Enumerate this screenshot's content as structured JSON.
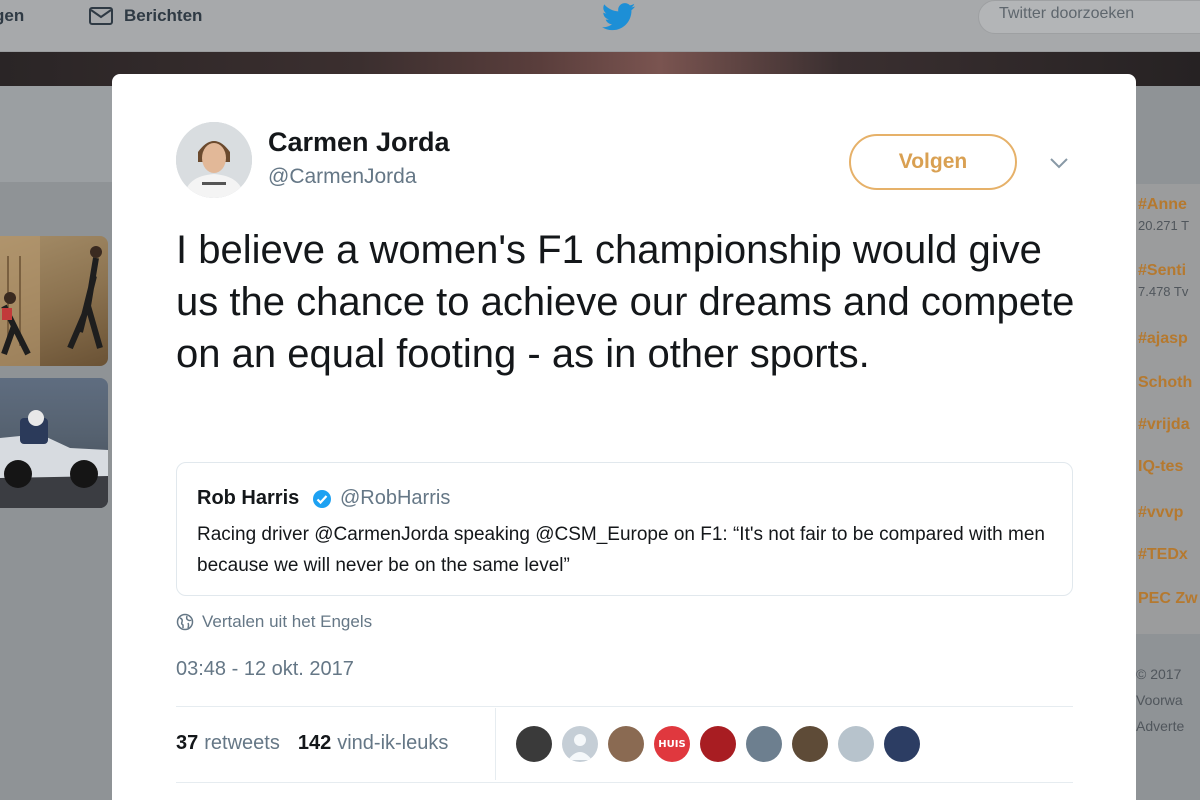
{
  "nav": {
    "left_partial": "gen",
    "messages_label": "Berichten",
    "search_placeholder": "Twitter doorzoeken"
  },
  "tweet": {
    "author_name": "Carmen Jorda",
    "author_handle": "@CarmenJorda",
    "follow_label": "Volgen",
    "text": "I believe a women's F1 championship would give us the chance to achieve our dreams and compete on an equal footing - as in other sports.",
    "quoted": {
      "name": "Rob Harris",
      "handle": "@RobHarris",
      "verified": true,
      "text": "Racing driver @CarmenJorda speaking @CSM_Europe on F1: “It's not fair to be compared with men because we will never be on the same level”"
    },
    "translate_label": "Vertalen uit het Engels",
    "timestamp": "03:48 - 12 okt. 2017",
    "retweets_count": "37",
    "retweets_label": "retweets",
    "likes_count": "142",
    "likes_label": "vind-ik-leuks",
    "liker_avatars": [
      {
        "icon": "avatar-photo",
        "color": "#3a3a3a"
      },
      {
        "icon": "default-avatar",
        "color": "#c5ced6"
      },
      {
        "icon": "avatar-photo",
        "color": "#8a6a52"
      },
      {
        "icon": "huis-logo",
        "color": "#e0383e",
        "text": "HUIS"
      },
      {
        "icon": "avatar-photo",
        "color": "#a81d22"
      },
      {
        "icon": "avatar-photo",
        "color": "#6d7f8f"
      },
      {
        "icon": "avatar-photo",
        "color": "#5e4b37"
      },
      {
        "icon": "avatar-photo",
        "color": "#b7c3cc"
      },
      {
        "icon": "avatar-photo",
        "color": "#2c3d63"
      }
    ]
  },
  "sidebar_trends": [
    {
      "tag": "#Anne",
      "count": "20.271 T"
    },
    {
      "tag": "#Senti",
      "count": "7.478 Tv"
    },
    {
      "tag": "#ajasp",
      "count": ""
    },
    {
      "tag": "Schoth",
      "count": ""
    },
    {
      "tag": "#vrijda",
      "count": ""
    },
    {
      "tag": "IQ-tes",
      "count": ""
    },
    {
      "tag": "#vvvp",
      "count": ""
    },
    {
      "tag": "#TEDx",
      "count": ""
    },
    {
      "tag": "PEC Zw",
      "count": ""
    }
  ],
  "sidebar_footer": [
    "© 2017",
    "Voorwa",
    "Adverte"
  ],
  "colors": {
    "twitter_blue": "#1da1f2",
    "follow_accent": "#e6b169",
    "text_primary": "#14171a",
    "text_secondary": "#657786"
  }
}
